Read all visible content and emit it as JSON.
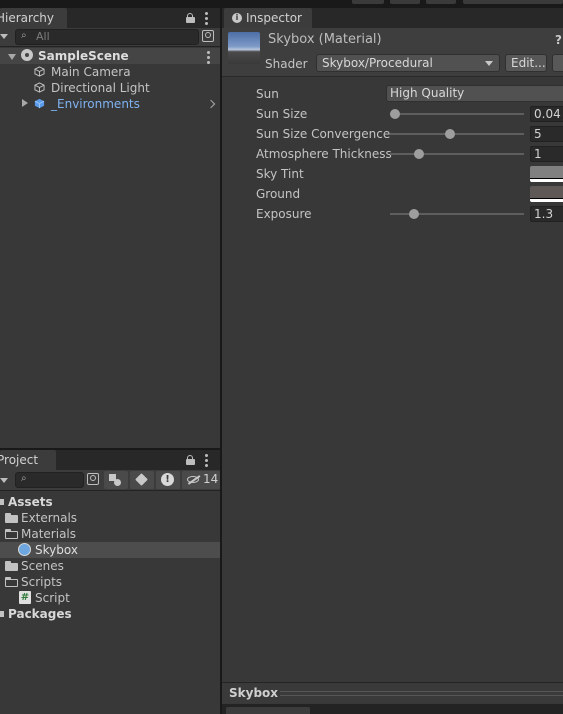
{
  "hierarchy": {
    "tab_label": "Hierarchy",
    "search_placeholder": "All",
    "scene_name": "SampleScene",
    "items": [
      {
        "label": "Main Camera"
      },
      {
        "label": "Directional Light"
      },
      {
        "label": "_Environments"
      }
    ]
  },
  "project": {
    "tab_label": "Project",
    "hidden_count": "14",
    "tree": [
      {
        "label": "Assets"
      },
      {
        "label": "Externals"
      },
      {
        "label": "Materials"
      },
      {
        "label": "Skybox"
      },
      {
        "label": "Scenes"
      },
      {
        "label": "Scripts"
      },
      {
        "label": "Script"
      },
      {
        "label": "Packages"
      }
    ],
    "script_icon_glyph": "#"
  },
  "inspector": {
    "tab_label": "Inspector",
    "info_glyph": "i",
    "help_glyph": "?",
    "title": "Skybox (Material)",
    "shader_label": "Shader",
    "shader_value": "Skybox/Procedural",
    "edit_button": "Edit...",
    "properties": {
      "sun": {
        "label": "Sun",
        "value": "High Quality"
      },
      "sun_size": {
        "label": "Sun Size",
        "value": "0.04",
        "slider_fraction": 0.04
      },
      "sun_size_convergence": {
        "label": "Sun Size Convergence",
        "value": "5",
        "slider_fraction": 0.45
      },
      "atmosphere_thickness": {
        "label": "Atmosphere Thickness",
        "value": "1",
        "slider_fraction": 0.22
      },
      "sky_tint": {
        "label": "Sky Tint",
        "color": "#808080"
      },
      "ground": {
        "label": "Ground",
        "color": "#5e5856"
      },
      "exposure": {
        "label": "Exposure",
        "value": "1.3",
        "slider_fraction": 0.18
      }
    },
    "preview_label": "Skybox"
  },
  "colors": {
    "panel_bg": "#383838",
    "selection": "#4d4d4d",
    "prefab_blue": "#7fb2f0",
    "divider": "#191919"
  }
}
